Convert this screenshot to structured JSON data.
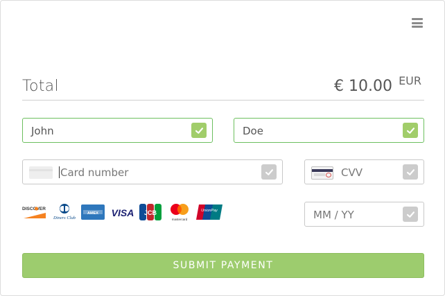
{
  "menu": {
    "icon": "hamburger-menu-icon"
  },
  "total": {
    "label": "Total",
    "amount": "€ 10.00",
    "currency": "EUR"
  },
  "form": {
    "first_name": {
      "value": "John",
      "valid": true
    },
    "last_name": {
      "value": "Doe",
      "valid": true
    },
    "card_number": {
      "placeholder": "Card number",
      "icon": "card-generic-icon"
    },
    "cvv": {
      "placeholder": "CVV",
      "icon": "card-back-icon"
    },
    "expiry": {
      "placeholder": "MM / YY"
    }
  },
  "brands": [
    {
      "name": "Discover",
      "label": "DISCOVER"
    },
    {
      "name": "Diners Club",
      "label": "Diners Club"
    },
    {
      "name": "American Express",
      "label": "AMEX"
    },
    {
      "name": "Visa",
      "label": "VISA"
    },
    {
      "name": "JCB",
      "label": "JCB"
    },
    {
      "name": "Mastercard",
      "label": "mastercard"
    },
    {
      "name": "UnionPay",
      "label": "UnionPay"
    }
  ],
  "submit": {
    "label": "SUBMIT PAYMENT"
  },
  "colors": {
    "valid_border": "#6cbf5e",
    "check_ok": "#a1cd6a",
    "check_neutral": "#cccccc",
    "submit_bg": "#9dcc6e"
  }
}
